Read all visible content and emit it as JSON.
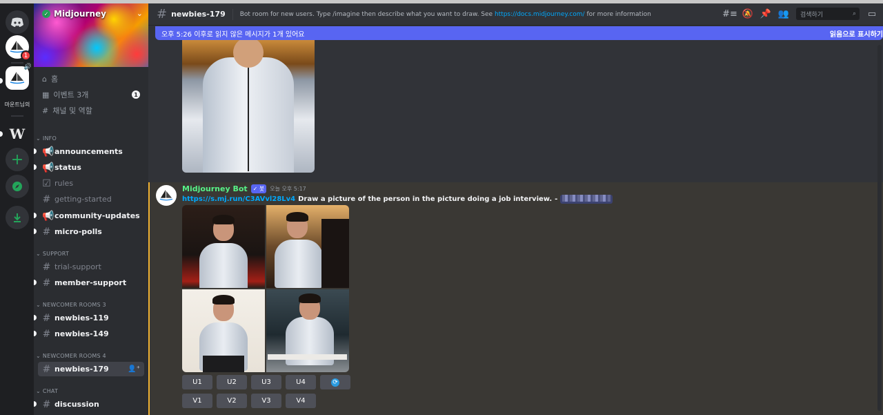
{
  "rail": {
    "server_label": "마운트님의",
    "unread_badge": "1",
    "volume_icon": "speaker-icon"
  },
  "server": {
    "name": "Midjourney",
    "home": "홈",
    "events": "이벤트 3개",
    "events_count": "1",
    "channels_roles": "채널 및 역할"
  },
  "categories": {
    "info": "INFO",
    "support": "SUPPORT",
    "newcomer3": "NEWCOMER ROOMS 3",
    "newcomer4": "NEWCOMER ROOMS 4",
    "chat": "CHAT"
  },
  "channels": {
    "announcements": "announcements",
    "status": "status",
    "rules": "rules",
    "getting_started": "getting-started",
    "community_updates": "community-updates",
    "micro_polls": "micro-polls",
    "trial_support": "trial-support",
    "member_support": "member-support",
    "newbies_119": "newbies-119",
    "newbies_149": "newbies-149",
    "newbies_179": "newbies-179",
    "discussion": "discussion"
  },
  "header": {
    "title": "newbies-179",
    "topic_pre": "Bot room for new users. Type /imagine then describe what you want to draw. See ",
    "topic_link": "https://docs.midjourney.com/",
    "topic_post": " for more information",
    "search_placeholder": "검색하기"
  },
  "unread_bar": {
    "text": "오후 5:26 이후로 읽지 않은 메시지가 1개 있어요",
    "action": "읽음으로 표시하기"
  },
  "message": {
    "author": "Midjourney Bot",
    "bot_tag": "✓ 봇",
    "timestamp": "오늘 오후 5:17",
    "link": "https://s.mj.run/C3AVvl28Lv4",
    "prompt": "Draw a picture of the person in the picture doing a job interview.",
    "separator": "-"
  },
  "buttons": {
    "u1": "U1",
    "u2": "U2",
    "u3": "U3",
    "u4": "U4",
    "v1": "V1",
    "v2": "V2",
    "v3": "V3",
    "v4": "V4"
  },
  "colors": {
    "accent": "#5865f2",
    "link": "#00a8fc",
    "bot_name": "#57f287",
    "highlight_border": "#f0b232"
  }
}
